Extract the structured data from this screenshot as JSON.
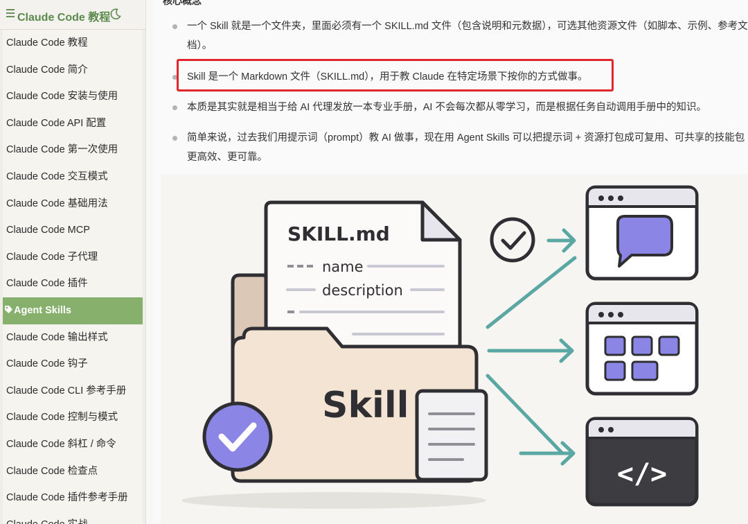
{
  "sidebar": {
    "title": "Claude Code 教程",
    "items": [
      {
        "label": "Claude Code 教程"
      },
      {
        "label": "Claude Code 简介"
      },
      {
        "label": "Claude Code 安装与使用"
      },
      {
        "label": "Claude Code API 配置"
      },
      {
        "label": "Claude Code 第一次使用"
      },
      {
        "label": "Claude Code 交互模式"
      },
      {
        "label": "Claude Code 基础用法"
      },
      {
        "label": "Claude Code MCP"
      },
      {
        "label": "Claude Code 子代理"
      },
      {
        "label": "Claude Code 插件"
      },
      {
        "label": "Agent Skills",
        "active": true
      },
      {
        "label": "Claude Code 输出样式"
      },
      {
        "label": "Claude Code 钩子"
      },
      {
        "label": "Claude Code CLI 参考手册"
      },
      {
        "label": "Claude Code 控制与模式"
      },
      {
        "label": "Claude Code 斜杠 / 命令"
      },
      {
        "label": "Claude Code 检查点"
      },
      {
        "label": "Claude Code 插件参考手册"
      },
      {
        "label": "Claude Code 实战"
      }
    ]
  },
  "content": {
    "heading": "核心概念",
    "bullets": [
      {
        "lines": [
          "一个 Skill 就是一个文件夹，里面必须有一个 SKILL.md 文件（包含说明和元数据），可选其他资源文件（如脚本、示例、参考文",
          "档）。"
        ]
      },
      {
        "lines": [
          "Skill 是一个 Markdown 文件（SKILL.md），用于教 Claude 在特定场景下按你的方式做事。"
        ]
      },
      {
        "lines": [
          "本质是其实就是相当于给 AI 代理发放一本专业手册，AI 不会每次都从零学习，而是根据任务自动调用手册中的知识。"
        ]
      },
      {
        "lines": [
          "简单来说，过去我们用提示词（prompt）教 AI 做事，现在用 Agent Skills 可以把提示词 + 资源打包成可复用、可共享的技能包",
          "更高效、更可靠。"
        ]
      }
    ]
  },
  "illustration": {
    "doc_title": "SKILL.md",
    "field_name": "name",
    "field_description": "description",
    "folder_label": "Skill",
    "code_icon": "</>"
  },
  "colors": {
    "accent_green": "#86b06b",
    "highlight_red": "#e0262b",
    "purple": "#8b86e6",
    "teal": "#5aa7a4"
  }
}
